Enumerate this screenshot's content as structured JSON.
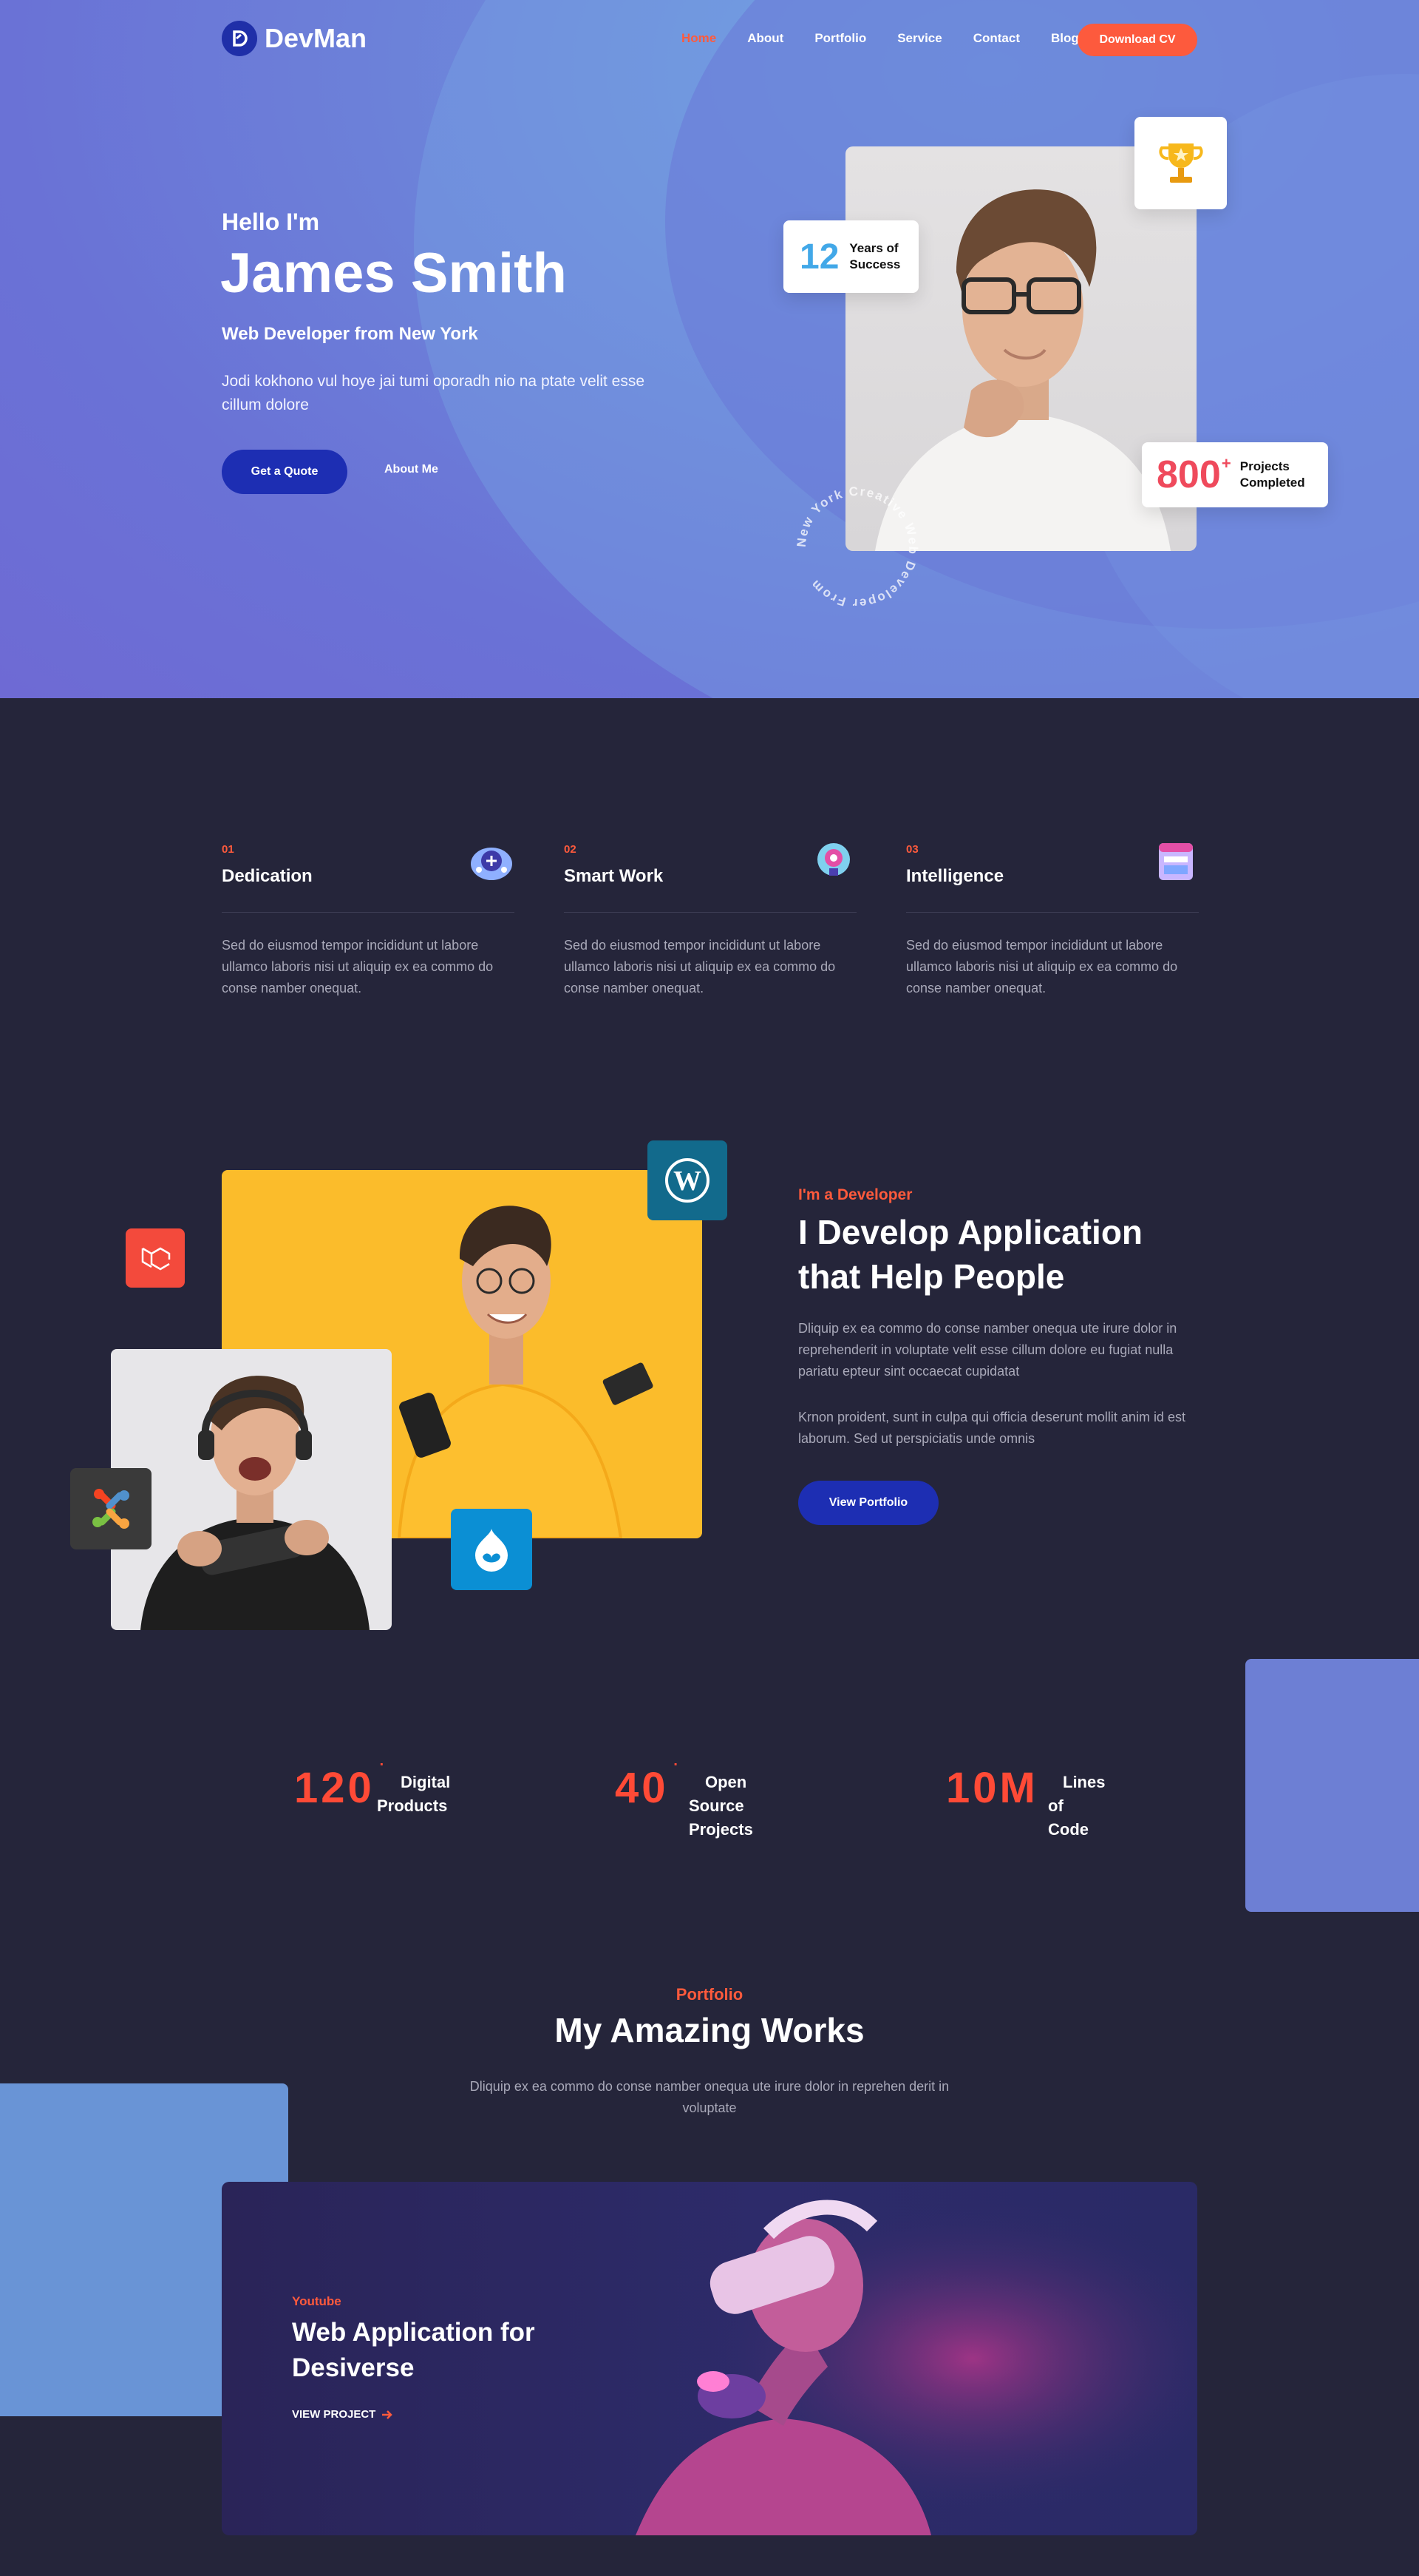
{
  "colors": {
    "accent": "#fd5a3d",
    "primary": "#1d2eb3",
    "dark_bg": "#25253a",
    "hero_bg": "#6d86da"
  },
  "nav": {
    "brand": "DevMan",
    "items": [
      {
        "label": "Home",
        "active": true
      },
      {
        "label": "About"
      },
      {
        "label": "Portfolio"
      },
      {
        "label": "Service"
      },
      {
        "label": "Contact"
      },
      {
        "label": "Blog"
      }
    ],
    "cta": "Download CV"
  },
  "hero": {
    "greeting": "Hello I'm",
    "name": "James Smith",
    "role": "Web Developer from New York",
    "intro": "Jodi kokhono vul hoye jai tumi oporadh nio na ptate velit esse cillum dolore",
    "primary_btn": "Get a Quote",
    "secondary_btn": "About Me",
    "years_num": "12",
    "years_label_1": "Years of",
    "years_label_2": "Success",
    "projects_num": "800",
    "projects_plus": "+",
    "projects_label_1": "Projects",
    "projects_label_2": "Completed",
    "circle_text": "New York Creative Web Developer From"
  },
  "features": [
    {
      "index": "01",
      "title": "Dedication",
      "icon": "brain-chip-icon",
      "desc": "Sed do eiusmod tempor incididunt ut labore ullamco laboris nisi ut aliquip ex ea commo do conse namber onequat."
    },
    {
      "index": "02",
      "title": "Smart Work",
      "icon": "lightbulb-gear-icon",
      "desc": "Sed do eiusmod tempor incididunt ut labore ullamco laboris nisi ut aliquip ex ea commo do conse namber onequat."
    },
    {
      "index": "03",
      "title": "Intelligence",
      "icon": "browser-window-icon",
      "desc": "Sed do eiusmod tempor incididunt ut labore ullamco laboris nisi ut aliquip ex ea commo do conse namber onequat."
    }
  ],
  "developer": {
    "tag": "I'm a Developer",
    "title": "I Develop Application that Help People",
    "p1": "Dliquip ex ea commo do conse namber onequa ute irure dolor in reprehenderit in voluptate velit esse cillum dolore eu fugiat nulla pariatu epteur sint occaecat cupidatat",
    "p2": "Krnon proident, sunt in culpa qui officia deserunt mollit anim id est laborum. Sed ut perspiciatis unde omnis",
    "btn": "View Portfolio"
  },
  "stats": [
    {
      "value": "120",
      "plus": "+",
      "label_1": "Digital",
      "label_2": "Products"
    },
    {
      "value": "40",
      "plus": "+",
      "label_1": "Open Source",
      "label_2": "Projects"
    },
    {
      "value": "10M",
      "plus": "",
      "label_1": "Lines of",
      "label_2": "Code"
    }
  ],
  "portfolio": {
    "tag": "Portfolio",
    "title": "My Amazing Works",
    "desc": "Dliquip ex ea commo do conse namber onequa ute irure dolor in reprehen derit in voluptate",
    "item": {
      "category": "Youtube",
      "title": "Web Application for Desiverse",
      "link": "VIEW PROJECT"
    }
  }
}
